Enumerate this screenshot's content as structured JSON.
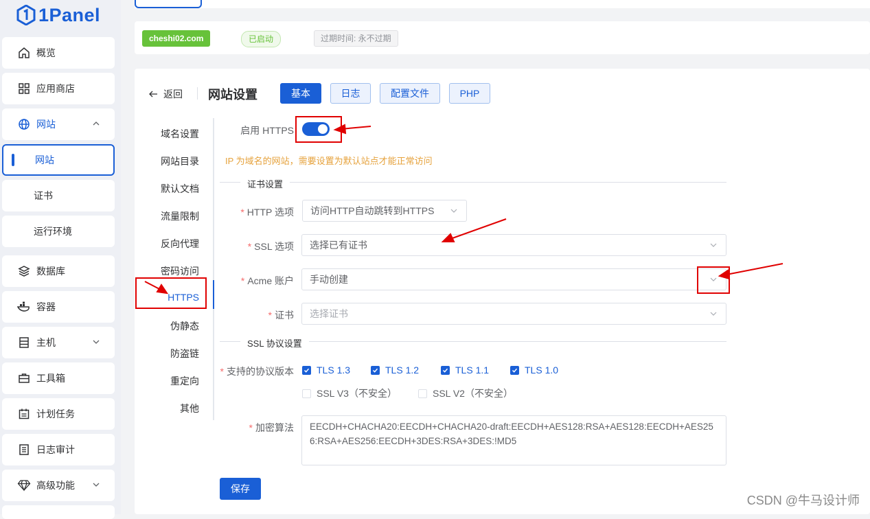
{
  "app": {
    "logo_text": "1Panel"
  },
  "sidebar": {
    "items": [
      {
        "label": "概览",
        "icon": "home-icon"
      },
      {
        "label": "应用商店",
        "icon": "apps-icon"
      },
      {
        "label": "网站",
        "icon": "globe-icon"
      },
      {
        "label": "网站"
      },
      {
        "label": "证书"
      },
      {
        "label": "运行环境"
      },
      {
        "label": "数据库",
        "icon": "database-icon"
      },
      {
        "label": "容器",
        "icon": "container-icon"
      },
      {
        "label": "主机",
        "icon": "host-icon"
      },
      {
        "label": "工具箱",
        "icon": "toolbox-icon"
      },
      {
        "label": "计划任务",
        "icon": "calendar-icon"
      },
      {
        "label": "日志审计",
        "icon": "log-icon"
      },
      {
        "label": "高级功能",
        "icon": "diamond-icon"
      }
    ]
  },
  "site_info": {
    "domain": "cheshi02.com",
    "status": "已启动",
    "expire": "过期时间: 永不过期"
  },
  "header": {
    "back_label": "返回",
    "title": "网站设置",
    "tabs": [
      "基本",
      "日志",
      "配置文件",
      "PHP"
    ]
  },
  "settings_menu": [
    "域名设置",
    "网站目录",
    "默认文档",
    "流量限制",
    "反向代理",
    "密码访问",
    "HTTPS",
    "伪静态",
    "防盗链",
    "重定向",
    "其他"
  ],
  "form": {
    "https_label": "启用 HTTPS",
    "https_enabled": true,
    "warning": "IP 为域名的网站，需要设置为默认站点才能正常访问",
    "cert_section": "证书设置",
    "http_option_label": "HTTP 选项",
    "http_option_value": "访问HTTP自动跳转到HTTPS",
    "ssl_option_label": "SSL 选项",
    "ssl_option_value": "选择已有证书",
    "acme_label": "Acme 账户",
    "acme_value": "手动创建",
    "cert_label": "证书",
    "cert_placeholder": "选择证书",
    "ssl_protocol_section": "SSL 协议设置",
    "protocol_label": "支持的协议版本",
    "protocols": [
      {
        "label": "TLS 1.3",
        "checked": true
      },
      {
        "label": "TLS 1.2",
        "checked": true
      },
      {
        "label": "TLS 1.1",
        "checked": true
      },
      {
        "label": "TLS 1.0",
        "checked": true
      },
      {
        "label": "SSL V3（不安全）",
        "checked": false
      },
      {
        "label": "SSL V2（不安全）",
        "checked": false
      }
    ],
    "cipher_label": "加密算法",
    "cipher_value": "EECDH+CHACHA20:EECDH+CHACHA20-draft:EECDH+AES128:RSA+AES128:EECDH+AES256:RSA+AES256:EECDH+3DES:RSA+3DES:!MD5",
    "save_label": "保存"
  },
  "watermark": "CSDN @牛马设计师",
  "colors": {
    "primary": "#1a5fd6",
    "success": "#67c23a",
    "warning": "#e6a23c",
    "danger": "#f56c6c",
    "annotation": "#e00000"
  }
}
